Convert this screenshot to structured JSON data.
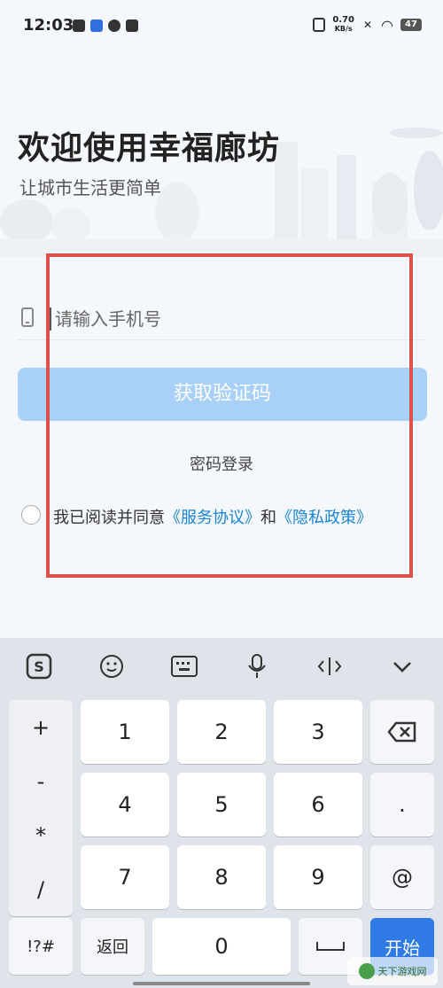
{
  "status_bar": {
    "time": "12:03",
    "speed_value": "0.70",
    "speed_unit": "KB/s",
    "battery": "47"
  },
  "header": {
    "title": "欢迎使用幸福廊坊",
    "subtitle": "让城市生活更简单"
  },
  "form": {
    "phone_placeholder": "请输入手机号",
    "get_code_label": "获取验证码",
    "password_login_label": "密码登录",
    "agree_prefix": "我已阅读并同意",
    "service_agreement": "《服务协议》",
    "agree_and": "和",
    "privacy_policy": "《隐私政策》"
  },
  "keyboard": {
    "side_symbols": [
      "+",
      "-",
      "*",
      "/"
    ],
    "digits": [
      "1",
      "2",
      "3",
      "4",
      "5",
      "6",
      "7",
      "8",
      "9",
      "0"
    ],
    "dot": ".",
    "at": "@",
    "symbols_label": "!?#",
    "back_label": "返回",
    "space_label": "␣",
    "start_label": "开始"
  },
  "watermark": {
    "text": "天下游戏网"
  },
  "colors": {
    "accent": "#a9d0f7",
    "link": "#1a84d6",
    "highlight": "#e0504a",
    "start_key": "#2f7ae5"
  }
}
